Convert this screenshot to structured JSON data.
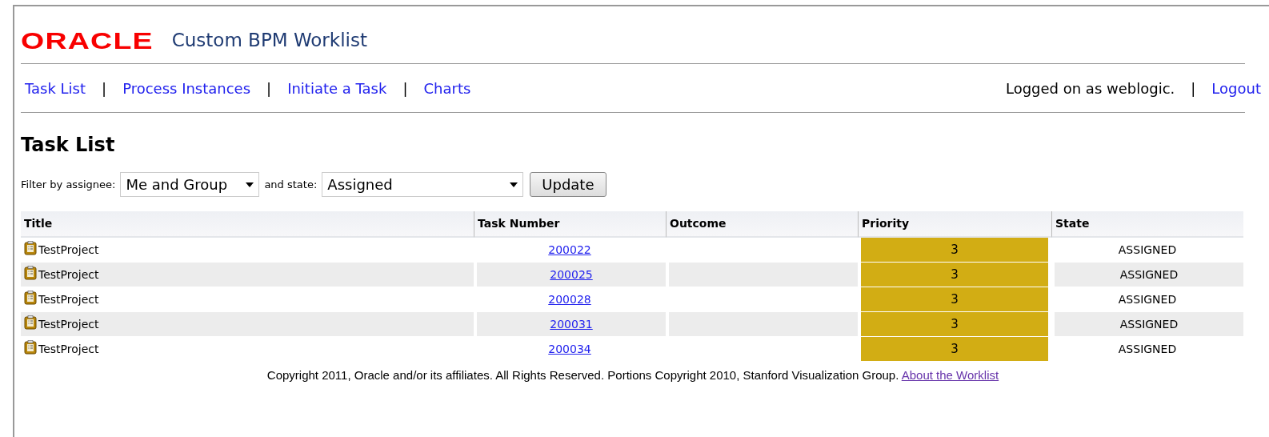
{
  "header": {
    "logo": "ORACLE",
    "title": "Custom BPM Worklist"
  },
  "nav": {
    "links": [
      "Task List",
      "Process Instances",
      "Initiate a Task",
      "Charts"
    ],
    "separator": "|",
    "user_text": "Logged on as weblogic.",
    "logout": "Logout"
  },
  "page_title": "Task List",
  "filter": {
    "assignee_label": "Filter by assignee:",
    "assignee_value": "Me and Group",
    "state_label": "and state:",
    "state_value": "Assigned",
    "button": "Update"
  },
  "table": {
    "columns": [
      "Title",
      "Task Number",
      "Outcome",
      "Priority",
      "State"
    ],
    "rows": [
      {
        "title": "TestProject",
        "task_number": "200022",
        "priority": "3",
        "state": "ASSIGNED"
      },
      {
        "title": "TestProject",
        "task_number": "200025",
        "priority": "3",
        "state": "ASSIGNED"
      },
      {
        "title": "TestProject",
        "task_number": "200028",
        "priority": "3",
        "state": "ASSIGNED"
      },
      {
        "title": "TestProject",
        "task_number": "200031",
        "priority": "3",
        "state": "ASSIGNED"
      },
      {
        "title": "TestProject",
        "task_number": "200034",
        "priority": "3",
        "state": "ASSIGNED"
      }
    ]
  },
  "footer": {
    "text": "Copyright 2011, Oracle and/or its affiliates. All Rights Reserved. Portions Copyright 2010, Stanford Visualization Group.",
    "link": "About the Worklist"
  }
}
